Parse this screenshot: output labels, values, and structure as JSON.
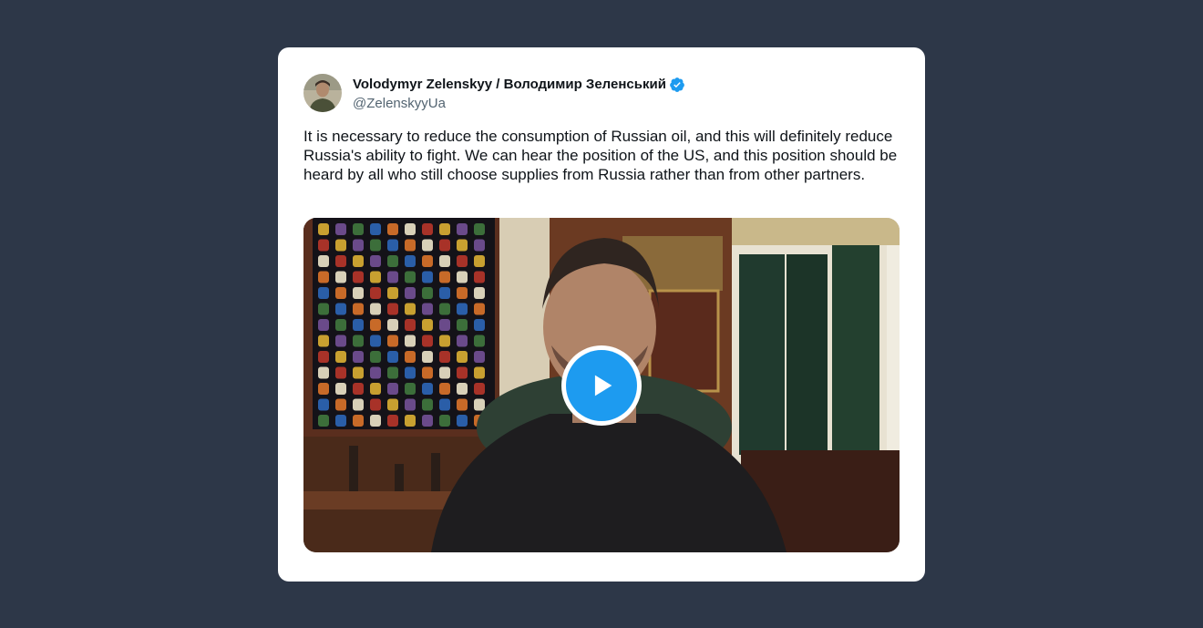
{
  "tweet": {
    "author": {
      "name": "Volodymyr Zelenskyy / Володимир Зеленський",
      "handle": "@ZelenskyyUa",
      "verified": true,
      "verified_icon": "verified-badge-icon",
      "avatar_icon": "avatar"
    },
    "text": "It is necessary to reduce the consumption of Russian oil, and this will definitely reduce Russia's ability to fight. We can hear the position of the US, and this position should be heard by all who still choose supplies from Russia rather than from other partners.",
    "media": {
      "type": "video",
      "play_icon": "play-icon"
    }
  },
  "colors": {
    "page_background": "#2d3748",
    "card_background": "#ffffff",
    "text_primary": "#0f1419",
    "text_secondary": "#536471",
    "accent": "#1d9bf0"
  }
}
